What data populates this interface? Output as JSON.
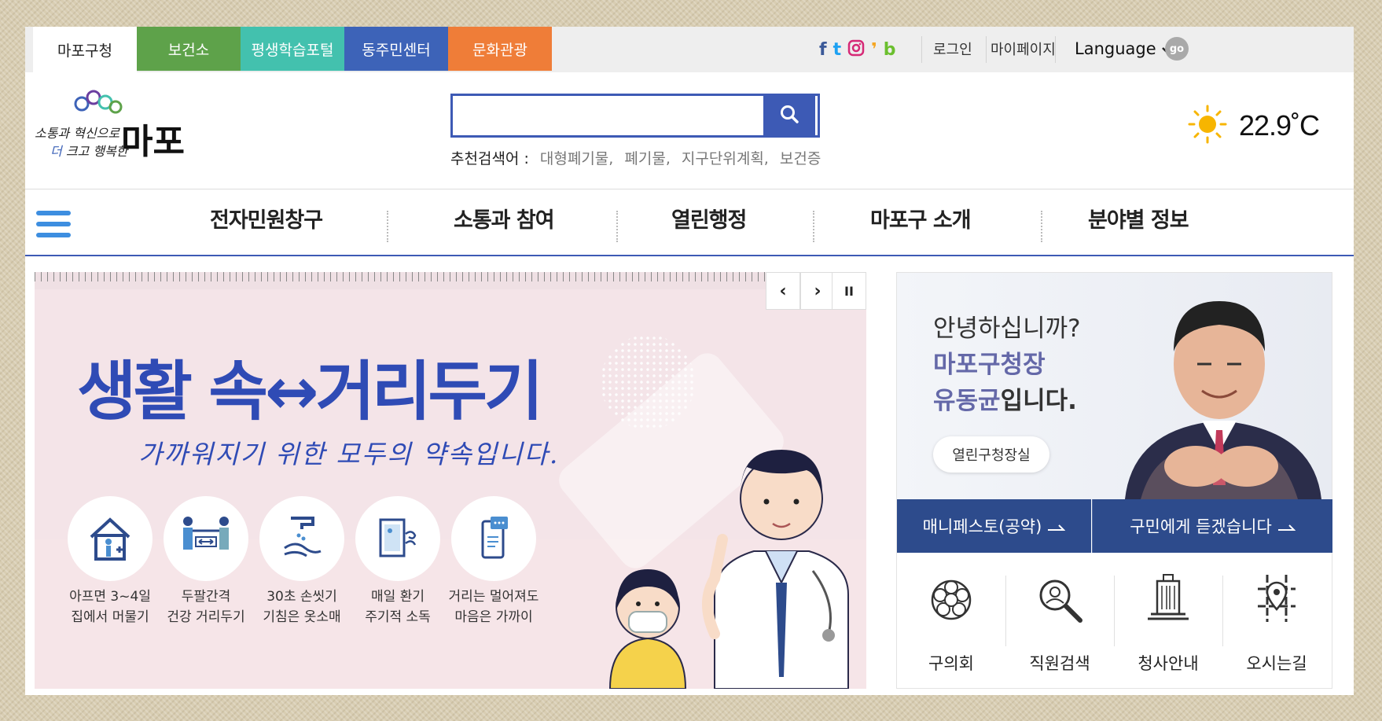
{
  "site_tabs": [
    {
      "label": "마포구청",
      "color": "#ffffff"
    },
    {
      "label": "보건소",
      "color": "#5ea24a"
    },
    {
      "label": "평생학습포털",
      "color": "#43c1ae"
    },
    {
      "label": "동주민센터",
      "color": "#3d63b8"
    },
    {
      "label": "문화관광",
      "color": "#ef7d38"
    }
  ],
  "util": {
    "login": "로그인",
    "mypage": "마이페이지",
    "language": "Language",
    "go": "go"
  },
  "search": {
    "placeholder": "",
    "recommend_label": "추천검색어 :",
    "keywords": [
      "대형폐기물,",
      "폐기물,",
      "지구단위계획,",
      "보건증"
    ]
  },
  "weather": {
    "temp": "22.9˚C"
  },
  "gnb": [
    "전자민원창구",
    "소통과 참여",
    "열린행정",
    "마포구 소개",
    "분야별 정보"
  ],
  "banner": {
    "title": "생활 속↔거리두기",
    "subtitle": "가까워지기 위한 모두의 약속입니다.",
    "items": [
      {
        "line1": "아프면 3~4일",
        "line2": "집에서 머물기"
      },
      {
        "line1": "두팔간격",
        "line2": "건강 거리두기"
      },
      {
        "line1": "30초 손씻기",
        "line2": "기침은 옷소매"
      },
      {
        "line1": "매일 환기",
        "line2": "주기적 소독"
      },
      {
        "line1": "거리는 멀어져도",
        "line2": "마음은 가까이"
      }
    ],
    "controls": {
      "prev": "‹",
      "next": "›",
      "pause": "II"
    }
  },
  "mayor": {
    "greeting": "안녕하십니까?",
    "title": "마포구청장",
    "name": "유동균",
    "suffix": "입니다.",
    "office_button": "열린구청장실",
    "manifesto": "매니페스토(공약)",
    "listen": "구민에게 듣겠습니다"
  },
  "quick_links": [
    "구의회",
    "직원검색",
    "청사안내",
    "오시는길"
  ],
  "colors": {
    "brand_blue": "#3d5ab5",
    "dark_blue": "#2d4b8c"
  }
}
